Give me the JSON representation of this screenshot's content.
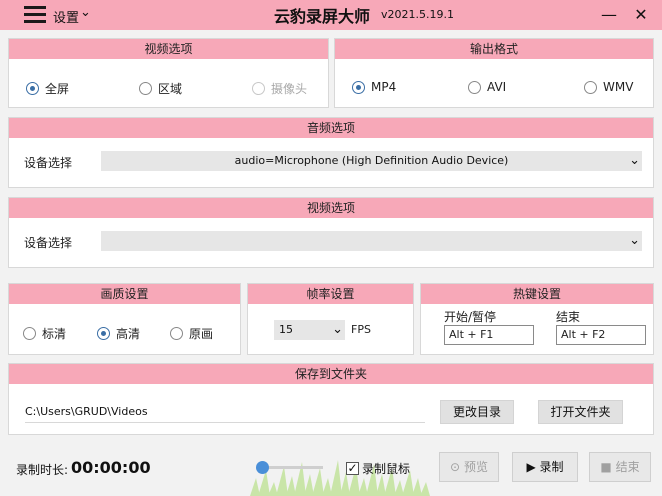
{
  "titlebar": {
    "settings_label": "设置",
    "settings_chevron": "⌄",
    "title": "云豹录屏大师",
    "version": "v2021.5.19.1",
    "minimize_glyph": "—",
    "close_glyph": "✕"
  },
  "video_options": {
    "heading": "视频选项",
    "options": [
      {
        "label": "全屏",
        "checked": true
      },
      {
        "label": "区域",
        "checked": false
      },
      {
        "label": "摄像头",
        "checked": false,
        "disabled": true
      }
    ]
  },
  "output_format": {
    "heading": "输出格式",
    "options": [
      {
        "label": "MP4",
        "checked": true
      },
      {
        "label": "AVI",
        "checked": false
      },
      {
        "label": "WMV",
        "checked": false
      }
    ]
  },
  "audio_options": {
    "heading": "音频选项",
    "device_label": "设备选择",
    "device_value": "audio=Microphone (High Definition Audio Device)"
  },
  "video_device": {
    "heading": "视频选项",
    "device_label": "设备选择",
    "device_value": ""
  },
  "quality": {
    "heading": "画质设置",
    "options": [
      {
        "label": "标清",
        "checked": false
      },
      {
        "label": "高清",
        "checked": true
      },
      {
        "label": "原画",
        "checked": false
      }
    ]
  },
  "framerate": {
    "heading": "帧率设置",
    "value": "15",
    "unit": "FPS"
  },
  "hotkeys": {
    "heading": "热键设置",
    "start_label": "开始/暂停",
    "start_value": "Alt + F1",
    "stop_label": "结束",
    "stop_value": "Alt + F2"
  },
  "save_folder": {
    "heading": "保存到文件夹",
    "path": "C:\\Users\\GRUD\\Videos",
    "change_dir_label": "更改目录",
    "open_folder_label": "打开文件夹"
  },
  "bottom": {
    "rec_time_label": "录制时长:",
    "rec_time_value": "00:00:00",
    "record_cursor_label": "录制鼠标",
    "record_cursor_checked": true,
    "preview_label": "预览",
    "record_label": "录制",
    "stop_label": "结束"
  },
  "icons": {
    "chevron": "⌄",
    "check": "✓",
    "preview": "⊙",
    "play": "▶",
    "stop": "■"
  },
  "colors": {
    "accent_pink": "#f7a8b8",
    "radio_blue": "#3a6ea5"
  }
}
